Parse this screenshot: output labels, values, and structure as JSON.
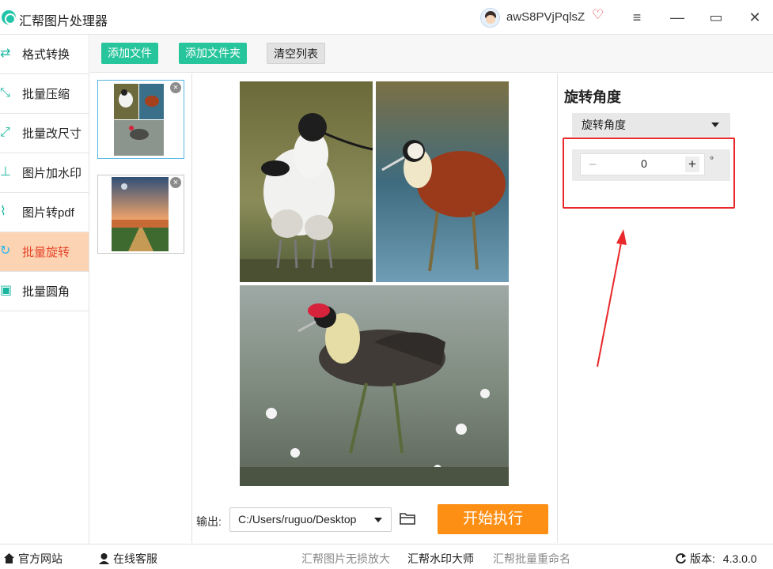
{
  "app": {
    "title": "汇帮图片处理器",
    "username": "awS8PVjPqlsZ"
  },
  "window_controls": {
    "menu": "≡",
    "minimize": "—",
    "maximize": "▭",
    "close": "✕"
  },
  "sidebar": {
    "items": [
      {
        "label": "格式转换",
        "icon": "format-convert-icon",
        "active": false
      },
      {
        "label": "批量压缩",
        "icon": "compress-icon",
        "active": false
      },
      {
        "label": "批量改尺寸",
        "icon": "resize-icon",
        "active": false
      },
      {
        "label": "图片加水印",
        "icon": "watermark-icon",
        "active": false
      },
      {
        "label": "图片转pdf",
        "icon": "pdf-icon",
        "active": false
      },
      {
        "label": "批量旋转",
        "icon": "rotate-icon",
        "active": true
      },
      {
        "label": "批量圆角",
        "icon": "round-corner-icon",
        "active": false
      }
    ]
  },
  "toolbar": {
    "add_file": "添加文件",
    "add_folder": "添加文件夹",
    "clear_list": "清空列表"
  },
  "output": {
    "label": "输出:",
    "path": "C:/Users/ruguo/Desktop"
  },
  "actions": {
    "start": "开始执行"
  },
  "settings": {
    "title": "旋转角度",
    "mode": "旋转角度",
    "angle_value": "0",
    "angle_unit": "°",
    "minus": "−",
    "plus": "+"
  },
  "footer": {
    "website": "官方网站",
    "support": "在线客服",
    "link1": "汇帮图片无损放大",
    "link2": "汇帮水印大师",
    "link3": "汇帮批量重命名",
    "version_label": "版本:",
    "version": "4.3.0.0"
  },
  "colors": {
    "accent_green": "#27c59c",
    "active_bg": "#fdd4b3",
    "active_text": "#e5462d",
    "start_orange": "#fd8f14",
    "highlight_red": "#e8282a"
  }
}
